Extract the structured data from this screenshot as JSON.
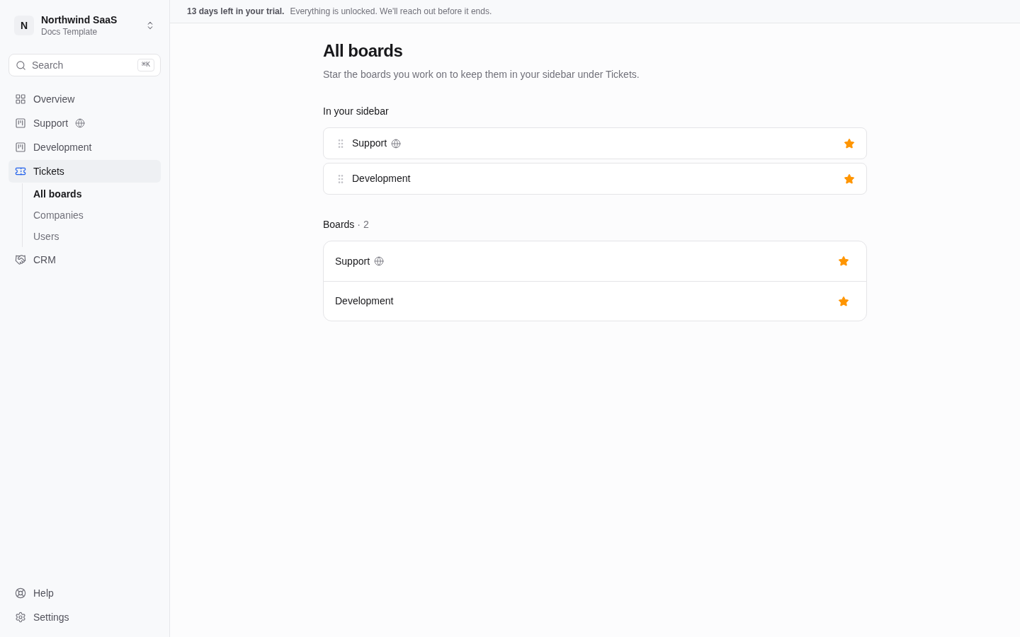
{
  "workspace": {
    "initial": "N",
    "name": "Northwind SaaS",
    "subtitle": "Docs Template"
  },
  "search": {
    "placeholder": "Search",
    "shortcut": "⌘K"
  },
  "nav": [
    {
      "kind": "grid",
      "label": "Overview",
      "public": false,
      "selected": false
    },
    {
      "kind": "board",
      "label": "Support",
      "public": true,
      "selected": false
    },
    {
      "kind": "board",
      "label": "Development",
      "public": false,
      "selected": false
    },
    {
      "kind": "ticket",
      "label": "Tickets",
      "public": false,
      "selected": true,
      "children": [
        {
          "label": "All boards",
          "selected": true
        },
        {
          "label": "Companies",
          "selected": false
        },
        {
          "label": "Users",
          "selected": false
        }
      ]
    },
    {
      "kind": "handshake",
      "label": "CRM",
      "public": false,
      "selected": false
    }
  ],
  "footer_nav": [
    {
      "kind": "help",
      "label": "Help"
    },
    {
      "kind": "settings",
      "label": "Settings"
    }
  ],
  "banner": {
    "title": "13 days left in your trial.",
    "message": "Everything is unlocked. We'll reach out before it ends."
  },
  "page": {
    "title": "All boards",
    "subtitle": "Star the boards you work on to keep them in your sidebar under Tickets."
  },
  "sidebar_section": {
    "heading": "In your sidebar",
    "boards": [
      {
        "name": "Support",
        "public": true,
        "starred": true
      },
      {
        "name": "Development",
        "public": false,
        "starred": true
      }
    ]
  },
  "boards_section": {
    "heading": "Boards",
    "count": "· 2",
    "boards": [
      {
        "name": "Support",
        "public": true,
        "starred": true
      },
      {
        "name": "Development",
        "public": false,
        "starred": true
      }
    ]
  }
}
